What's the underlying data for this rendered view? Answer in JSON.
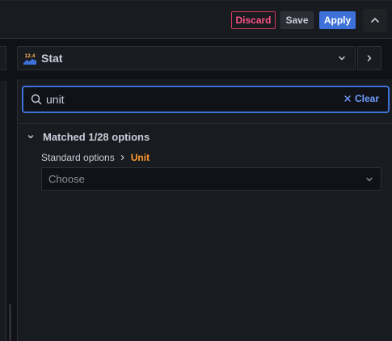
{
  "toolbar": {
    "discard_label": "Discard",
    "save_label": "Save",
    "apply_label": "Apply"
  },
  "visualization": {
    "label": "Stat",
    "icon": "stat-viz-icon",
    "icon_text": "12.4"
  },
  "search": {
    "value": "unit",
    "clear_label": "Clear"
  },
  "results": {
    "summary": "Matched 1/28 options",
    "breadcrumb_parent": "Standard options",
    "breadcrumb_current": "Unit",
    "select_placeholder": "Choose"
  },
  "colors": {
    "accent": "#3d71d9",
    "discard": "#ff5286",
    "highlight": "#ff9830",
    "link": "#6e9fff"
  }
}
